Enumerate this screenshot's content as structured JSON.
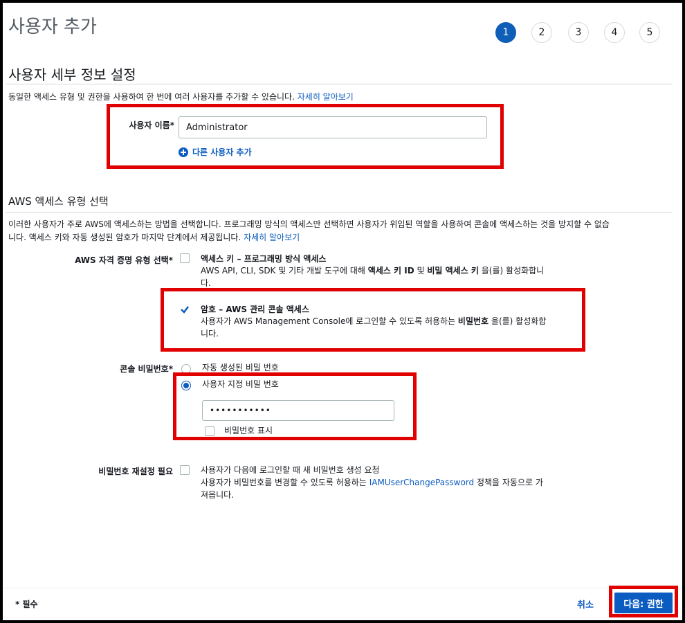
{
  "page_title": "사용자 추가",
  "steps": [
    "1",
    "2",
    "3",
    "4",
    "5"
  ],
  "section1": {
    "title": "사용자 세부 정보 설정",
    "description": "동일한 액세스 유형 및 권한을 사용하여 한 번에 여러 사용자를 추가할 수 있습니다.",
    "learn_more": "자세히 알아보기",
    "username_label": "사용자 이름*",
    "username_value": "Administrator",
    "add_user_link": "다른 사용자 추가"
  },
  "section2": {
    "title": "AWS 액세스 유형 선택",
    "description_line1": "이러한 사용자가 주로 AWS에 액세스하는 방법을 선택합니다. 프로그래밍 방식의 액세스만 선택하면 사용자가 위임된 역할을 사용하여 콘솔에 액세스하는 것을 방지할 수 없습",
    "description_line2": "니다. 액세스 키와 자동 생성된 암호가 마지막 단계에서 제공됩니다.",
    "learn_more": "자세히 알아보기",
    "credential_label": "AWS 자격 증명 유형 선택*",
    "access_key": {
      "title": "액세스 키 – 프로그래밍 방식 액세스",
      "desc_pre": "AWS API, CLI, SDK 및 기타 개발 도구에 대해 ",
      "desc_bold1": "액세스 키 ID",
      "desc_mid": " 및 ",
      "desc_bold2": "비밀 액세스 키",
      "desc_post": " 을(를) 활성화합니",
      "desc_line2": "다."
    },
    "password_access": {
      "title": "암호 – AWS 관리 콘솔 액세스",
      "desc_pre": "사용자가 AWS Management Console에 로그인할 수 있도록 허용하는 ",
      "desc_bold": "비밀번호",
      "desc_post": " 을(를) 활성화합",
      "desc_line2": "니다."
    },
    "console_password_label": "콘솔 비밀번호*",
    "auto_password": "자동 생성된 비밀 번호",
    "custom_password": "사용자 지정 비밀 번호",
    "password_value": "•••••••••••",
    "show_password": "비밀번호 표시",
    "reset_label": "비밀번호 재설정 필요",
    "reset_option": "사용자가 다음에 로그인할 때 새 비밀번호 생성 요청",
    "reset_desc_pre": "사용자가 비밀번호를 변경할 수 있도록 허용하는 ",
    "reset_desc_link": "IAMUserChangePassword",
    "reset_desc_post": " 정책을 자동으로 가",
    "reset_desc_line2": "져옵니다."
  },
  "footer": {
    "required_note": "* 필수",
    "cancel": "취소",
    "next": "다음: 권한"
  },
  "colors": {
    "primary": "#0b5cc0",
    "highlight": "#e00000",
    "step_active": "#0f5fb8"
  }
}
